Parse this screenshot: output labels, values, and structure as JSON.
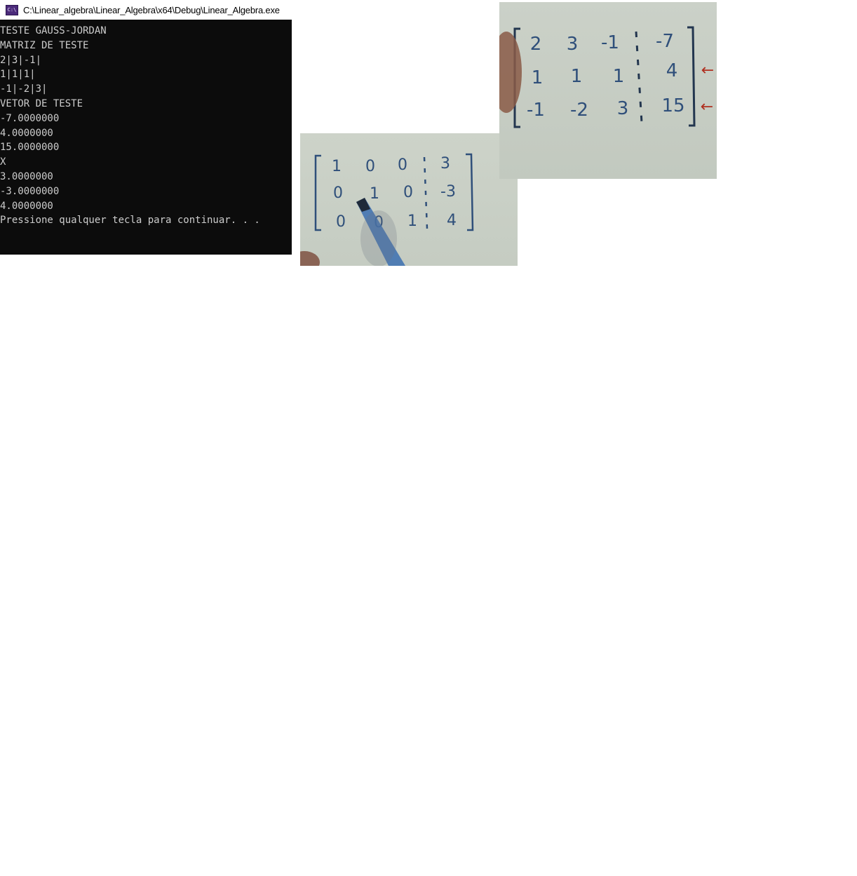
{
  "console": {
    "title": "C:\\Linear_algebra\\Linear_Algebra\\x64\\Debug\\Linear_Algebra.exe",
    "icon_label": "C:\\",
    "lines": [
      "TESTE GAUSS-JORDAN",
      "MATRIZ DE TESTE",
      "2|3|-1|",
      "1|1|1|",
      "-1|-2|3|",
      "VETOR DE TESTE",
      "-7.0000000",
      "4.0000000",
      "15.0000000",
      "X",
      "3.0000000",
      "-3.0000000",
      "4.0000000",
      "Pressione qualquer tecla para continuar. . ."
    ]
  },
  "photo_original": {
    "rows": [
      [
        "2",
        "3",
        "-1",
        "-7"
      ],
      [
        "1",
        "1",
        "1",
        "4"
      ],
      [
        "-1",
        "-2",
        "3",
        "15"
      ]
    ],
    "arrow_glyph": "←",
    "arrow_color": "#b03020"
  },
  "photo_rref": {
    "rows": [
      [
        "1",
        "0",
        "0",
        "3"
      ],
      [
        "0",
        "1",
        "0",
        "-3"
      ],
      [
        "0",
        "0",
        "1",
        "4"
      ]
    ]
  },
  "colors": {
    "console_bg": "#0c0c0c",
    "console_text": "#cccccc",
    "ink": "#2f4f7a"
  }
}
